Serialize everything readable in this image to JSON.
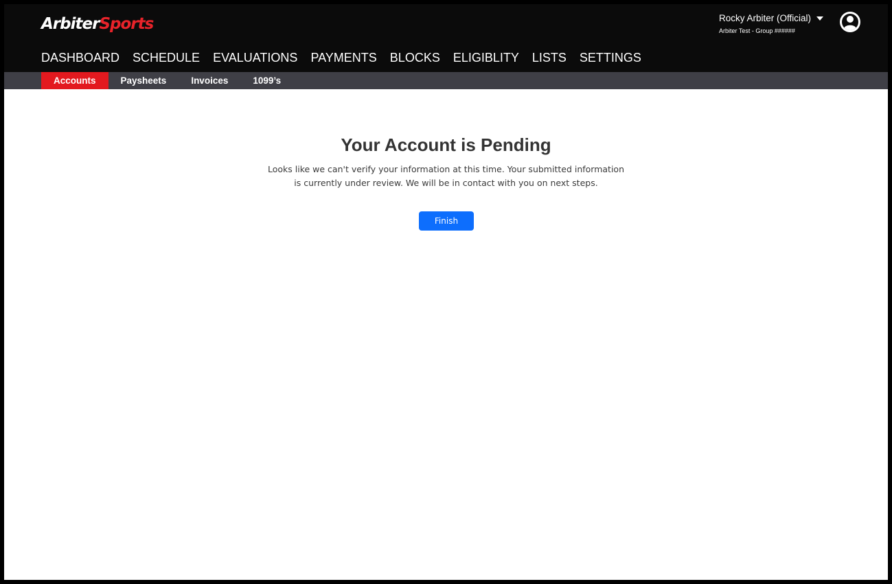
{
  "brand": {
    "logo_part1": "Arbiter",
    "logo_part2": "Sports",
    "accent_color": "#e3191f"
  },
  "user": {
    "name": "Rocky Arbiter (Official)",
    "group": "Arbiter Test - Group ######",
    "menu_icon": "chevron-down-icon",
    "avatar_icon": "user-avatar-icon"
  },
  "main_nav": {
    "items": [
      {
        "label": "DASHBOARD"
      },
      {
        "label": "SCHEDULE"
      },
      {
        "label": "EVALUATIONS"
      },
      {
        "label": "PAYMENTS"
      },
      {
        "label": "BLOCKS"
      },
      {
        "label": "ELIGIBLITY"
      },
      {
        "label": "LISTS"
      },
      {
        "label": "SETTINGS"
      }
    ]
  },
  "sub_nav": {
    "active": "Accounts",
    "items": [
      {
        "label": "Accounts"
      },
      {
        "label": "Paysheets"
      },
      {
        "label": "Invoices"
      },
      {
        "label": "1099’s"
      }
    ]
  },
  "main": {
    "title": "Your Account is Pending",
    "message_line1": "Looks like we can't verify your information at this time. Your submitted information",
    "message_line2": "is currently under review. We will be in contact with you on next steps.",
    "finish_label": "Finish",
    "button_color": "#0d6efd"
  }
}
